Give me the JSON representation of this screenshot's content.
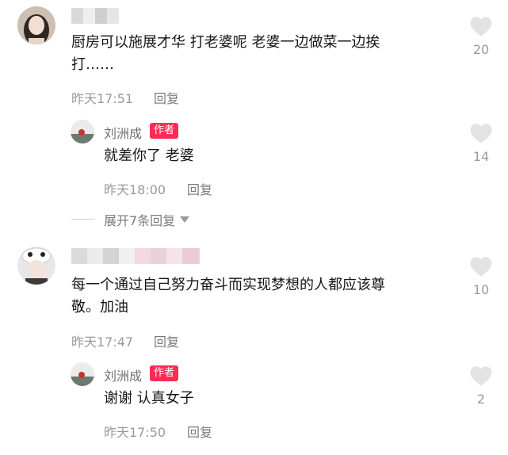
{
  "comments": [
    {
      "username": "",
      "text_line1": "厨房可以施展才华 打老婆呢 老婆一边做菜一边挨",
      "text_line2": "打……",
      "time": "昨天17:51",
      "reply_label": "回复",
      "likes": "20",
      "reply": {
        "username": "刘洲成",
        "badge": "作者",
        "text": "就差你了 老婆",
        "time": "昨天18:00",
        "reply_label": "回复",
        "likes": "14"
      },
      "expand_label": "展开7条回复"
    },
    {
      "username": "",
      "text_line1": "每一个通过自己努力奋斗而实现梦想的人都应该尊",
      "text_line2": "敬。加油",
      "time": "昨天17:47",
      "reply_label": "回复",
      "likes": "10",
      "reply": {
        "username": "刘洲成",
        "badge": "作者",
        "text": "谢谢 认真女子",
        "time": "昨天17:50",
        "reply_label": "回复",
        "likes": "2"
      }
    }
  ],
  "icons": {
    "like": "heart-icon",
    "expand": "triangle-down-icon"
  },
  "colors": {
    "author_badge": "#fe2c55",
    "like_heart": "#e3e3e3",
    "meta_text": "#9a9a9a"
  }
}
